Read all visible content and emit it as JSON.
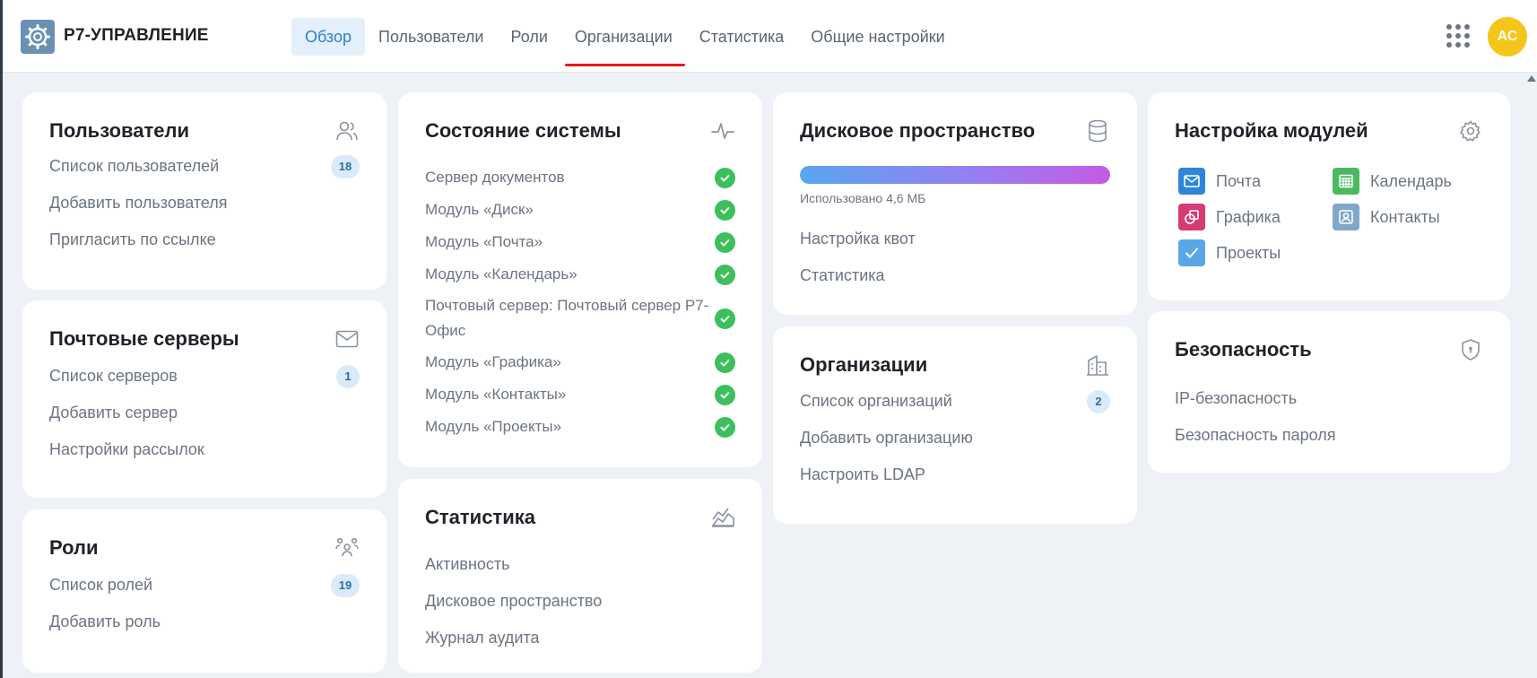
{
  "header": {
    "brand": "Р7-УПРАВЛЕНИЕ",
    "nav": [
      {
        "label": "Обзор"
      },
      {
        "label": "Пользователи"
      },
      {
        "label": "Роли"
      },
      {
        "label": "Организации"
      },
      {
        "label": "Статистика"
      },
      {
        "label": "Общие настройки"
      }
    ],
    "active_tab": "Обзор",
    "avatar_initials": "АС"
  },
  "users_card": {
    "title": "Пользователи",
    "icon": "users-icon",
    "links": [
      {
        "label": "Список пользователей",
        "badge": "18"
      },
      {
        "label": "Добавить пользователя"
      },
      {
        "label": "Пригласить по ссылке"
      }
    ]
  },
  "mail_servers_card": {
    "title": "Почтовые серверы",
    "icon": "envelope-icon",
    "links": [
      {
        "label": "Список серверов",
        "badge": "1"
      },
      {
        "label": "Добавить сервер"
      },
      {
        "label": "Настройки рассылок"
      }
    ]
  },
  "roles_card": {
    "title": "Роли",
    "icon": "roles-icon",
    "links": [
      {
        "label": "Список ролей",
        "badge": "19"
      },
      {
        "label": "Добавить роль"
      }
    ]
  },
  "system_status_card": {
    "title": "Состояние системы",
    "icon": "pulse-icon",
    "items": [
      {
        "label": "Сервер документов",
        "status": "ok"
      },
      {
        "label": "Модуль «Диск»",
        "status": "ok"
      },
      {
        "label": "Модуль «Почта»",
        "status": "ok"
      },
      {
        "label": "Модуль «Календарь»",
        "status": "ok"
      },
      {
        "label": "Почтовый сервер: Почтовый сервер Р7-Офис",
        "status": "ok"
      },
      {
        "label": "Модуль «Графика»",
        "status": "ok"
      },
      {
        "label": "Модуль «Контакты»",
        "status": "ok"
      },
      {
        "label": "Модуль «Проекты»",
        "status": "ok"
      }
    ]
  },
  "statistics_card": {
    "title": "Статистика",
    "icon": "chart-area-icon",
    "links": [
      {
        "label": "Активность"
      },
      {
        "label": "Дисковое пространство"
      },
      {
        "label": "Журнал аудита"
      }
    ]
  },
  "disk_card": {
    "title": "Дисковое пространство",
    "icon": "database-icon",
    "usage_label": "Использовано 4,6 МБ",
    "usage_fraction": 1.0,
    "links": [
      {
        "label": "Настройка квот"
      },
      {
        "label": "Статистика"
      }
    ]
  },
  "organizations_card": {
    "title": "Организации",
    "icon": "building-icon",
    "links": [
      {
        "label": "Список организаций",
        "badge": "2"
      },
      {
        "label": "Добавить организацию"
      },
      {
        "label": "Настроить LDAP"
      }
    ]
  },
  "modules_card": {
    "title": "Настройка модулей",
    "icon": "gear-icon",
    "modules": [
      {
        "label": "Почта",
        "icon": "mail-module-icon",
        "color": "#2f86d9"
      },
      {
        "label": "Календарь",
        "icon": "calendar-module-icon",
        "color": "#4cb860"
      },
      {
        "label": "Графика",
        "icon": "graphics-module-icon",
        "color": "#d63a73"
      },
      {
        "label": "Контакты",
        "icon": "contacts-module-icon",
        "color": "#7fa8c9"
      },
      {
        "label": "Проекты",
        "icon": "projects-module-icon",
        "color": "#5aa7e8"
      }
    ]
  },
  "security_card": {
    "title": "Безопасность",
    "icon": "shield-icon",
    "links": [
      {
        "label": "IP-безопасность"
      },
      {
        "label": "Безопасность пароля"
      }
    ]
  }
}
